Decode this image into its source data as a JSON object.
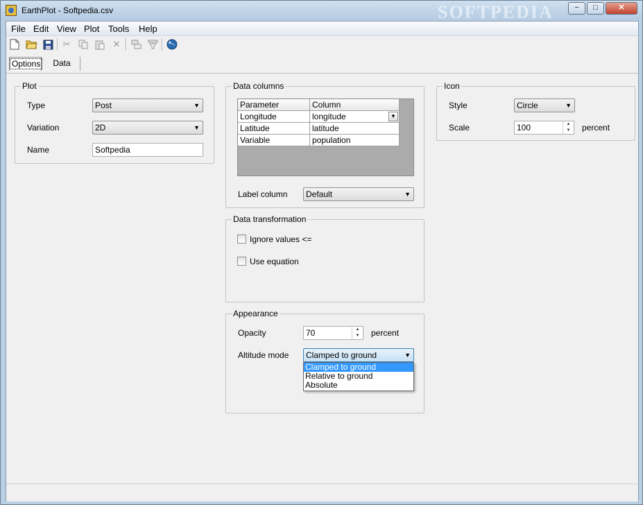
{
  "window": {
    "title": "EarthPlot - Softpedia.csv",
    "watermark": "SOFTPEDIA",
    "minimize": "−",
    "maximize": "□",
    "close": "✕"
  },
  "menu": [
    "File",
    "Edit",
    "View",
    "Plot",
    "Tools",
    "Help"
  ],
  "toolbar": {
    "new": "new-file-icon",
    "open": "open-folder-icon",
    "save": "save-disk-icon",
    "cut": "cut-icon",
    "copy": "copy-icon",
    "paste": "paste-icon",
    "delete": "delete-icon",
    "icon_a": "layer-icon",
    "icon_b": "filter-icon",
    "globe": "globe-icon"
  },
  "tabs": {
    "options": "Options",
    "data": "Data"
  },
  "plot": {
    "legend": "Plot",
    "type_label": "Type",
    "type_value": "Post",
    "variation_label": "Variation",
    "variation_value": "2D",
    "name_label": "Name",
    "name_value": "Softpedia"
  },
  "data_columns": {
    "legend": "Data columns",
    "headers": [
      "Parameter",
      "Column"
    ],
    "rows": [
      [
        "Longitude",
        "longitude"
      ],
      [
        "Latitude",
        "latitude"
      ],
      [
        "Variable",
        "population"
      ]
    ],
    "label_column_label": "Label column",
    "label_column_value": "Default"
  },
  "icon": {
    "legend": "Icon",
    "style_label": "Style",
    "style_value": "Circle",
    "scale_label": "Scale",
    "scale_value": "100",
    "scale_unit": "percent"
  },
  "data_transformation": {
    "legend": "Data transformation",
    "ignore_label": "Ignore values <=",
    "equation_label": "Use equation"
  },
  "appearance": {
    "legend": "Appearance",
    "opacity_label": "Opacity",
    "opacity_value": "70",
    "opacity_unit": "percent",
    "altitude_label": "Altitude mode",
    "altitude_value": "Clamped to ground",
    "altitude_options": [
      "Clamped to ground",
      "Relative to ground",
      "Absolute"
    ]
  }
}
